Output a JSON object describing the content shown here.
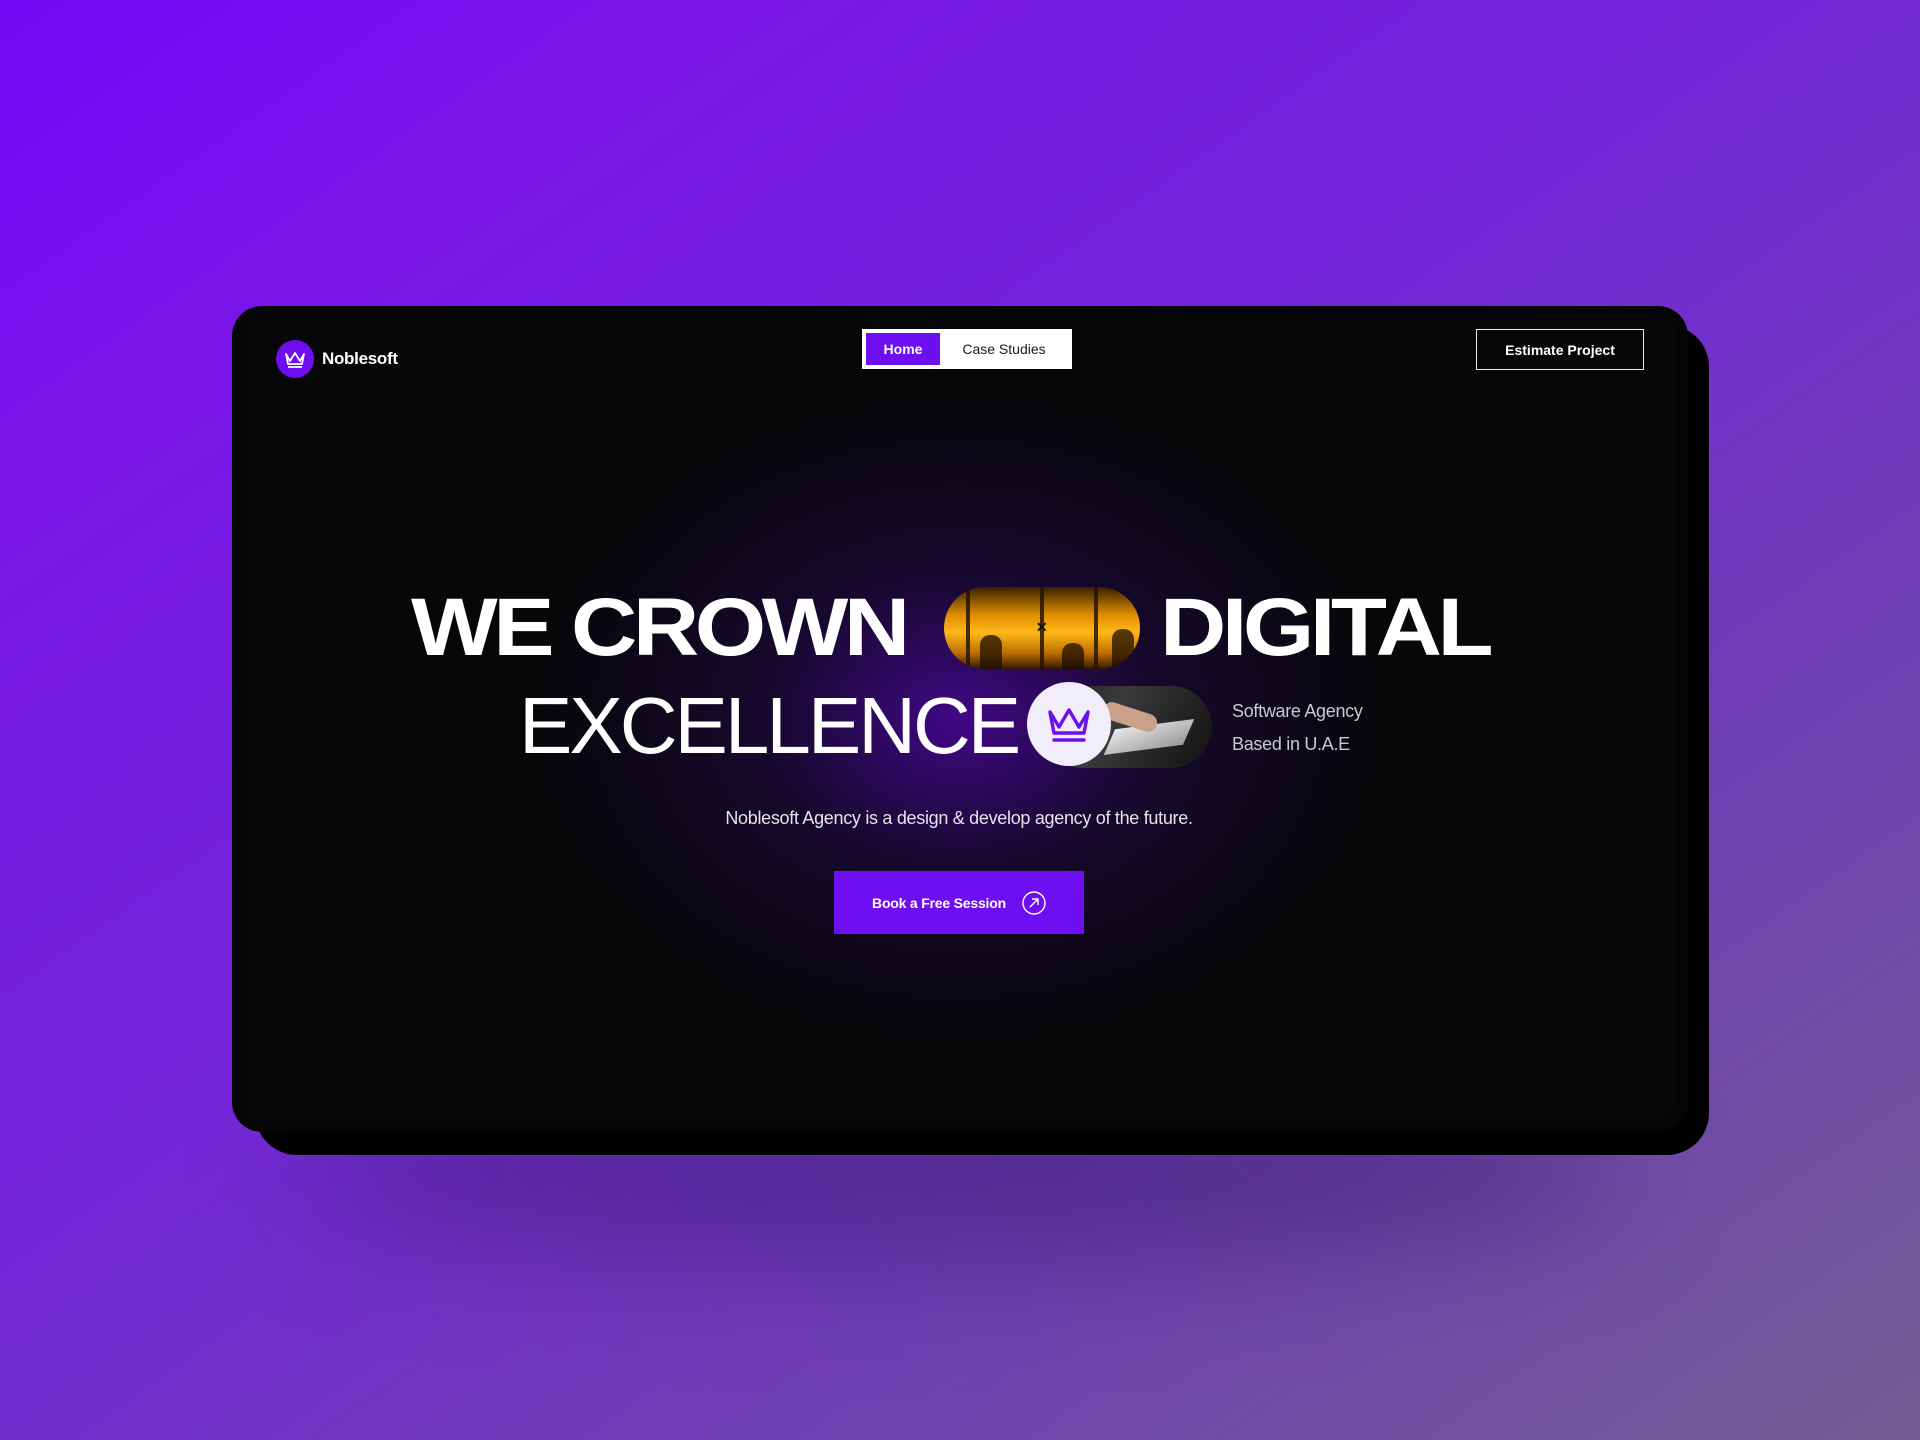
{
  "brand": {
    "name": "Noblesoft",
    "accent": "#6d0ff0",
    "logo_icon": "crown-icon"
  },
  "nav": {
    "items": [
      {
        "label": "Home",
        "active": true
      },
      {
        "label": "Case Studies",
        "active": false
      }
    ]
  },
  "header": {
    "cta_label": "Estimate Project"
  },
  "hero": {
    "line1_left": "WE CROWN",
    "line1_right": "DIGITAL",
    "line2": "EXCELLENCE",
    "tagline_line1": "Software Agency",
    "tagline_line2": "Based in U.A.E",
    "subtext": "Noblesoft Agency is a design & develop agency of the future.",
    "cta_label": "Book a Free Session",
    "cta_icon": "arrow-up-right-circle-icon",
    "badge_icon": "crown-icon"
  },
  "colors": {
    "background_gradient": [
      "#7206f6",
      "#735d93"
    ],
    "screen_bg": "#07070a",
    "text": "#ffffff"
  }
}
